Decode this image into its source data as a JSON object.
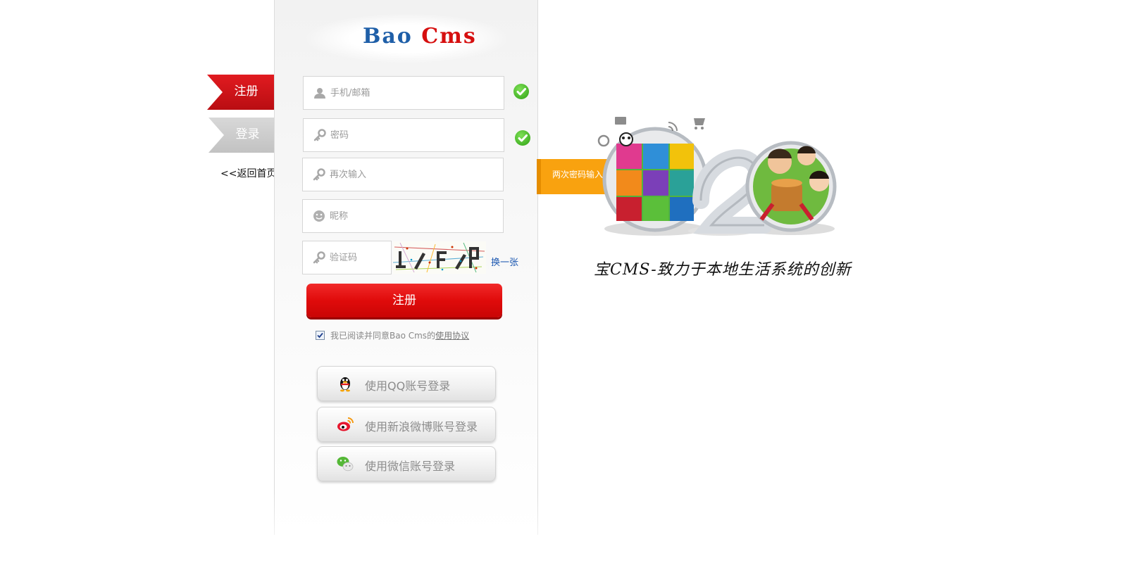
{
  "logo": {
    "part1": "Bao",
    "part2": "Cms"
  },
  "tabs": {
    "register": "注册",
    "login": "登录"
  },
  "back_link": "<<返回首页",
  "form": {
    "account": {
      "placeholder": "手机/邮箱",
      "value": ""
    },
    "password": {
      "placeholder": "密码",
      "value": ""
    },
    "password_confirm": {
      "placeholder": "再次输入",
      "value": ""
    },
    "nickname": {
      "placeholder": "昵称",
      "value": ""
    },
    "captcha": {
      "placeholder": "验证码",
      "value": ""
    },
    "captcha_refresh": "换一张",
    "submit": "注册",
    "agreement_text": "我已阅读并同意Bao Cms的",
    "agreement_link": "使用协议",
    "agreement_checked": true
  },
  "social": {
    "qq": "使用QQ账号登录",
    "weibo": "使用新浪微博账号登录",
    "wechat": "使用微信账号登录"
  },
  "error_tip": "两次密码输入不一致",
  "promo": {
    "tagline": "宝CMS-致力于本地生活系统的创新"
  },
  "colors": {
    "brand_red": "#e00b0b",
    "brand_blue": "#1f5fa8",
    "warning": "#f9a20f",
    "success": "#3cb01a"
  }
}
